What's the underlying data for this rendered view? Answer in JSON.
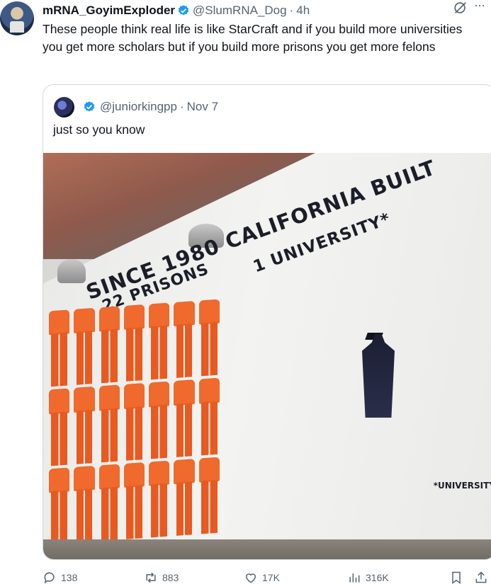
{
  "tweet": {
    "author_name": "mRNA_GoyimExploder",
    "handle": "@SlumRNA_Dog",
    "separator": "·",
    "time": "4h",
    "text": "These people think real life is like StarCraft and if you build more universities you get more scholars but if you build more prisons you get more felons",
    "more_menu": "···"
  },
  "quote": {
    "handle": "@juniorkingpp",
    "separator": "·",
    "date": "Nov 7",
    "text": "just so you know",
    "image": {
      "line1": "SINCE 1980 CALIFORNIA BUILT",
      "line2": "22 PRISONS",
      "line3": "1 UNIVERSITY*",
      "footnote": "*UNIVERSITY"
    }
  },
  "actions": {
    "replies": "138",
    "reposts": "883",
    "likes": "17K",
    "views": "316K"
  },
  "colors": {
    "verified": "#1d9bf0",
    "secondary_text": "#536471",
    "border": "#cfd9de",
    "jumpsuit": "#ef6a2c"
  },
  "icons": [
    "verified-icon",
    "grok-icon",
    "more-icon",
    "reply-icon",
    "repost-icon",
    "like-icon",
    "views-icon",
    "bookmark-icon",
    "share-icon"
  ]
}
